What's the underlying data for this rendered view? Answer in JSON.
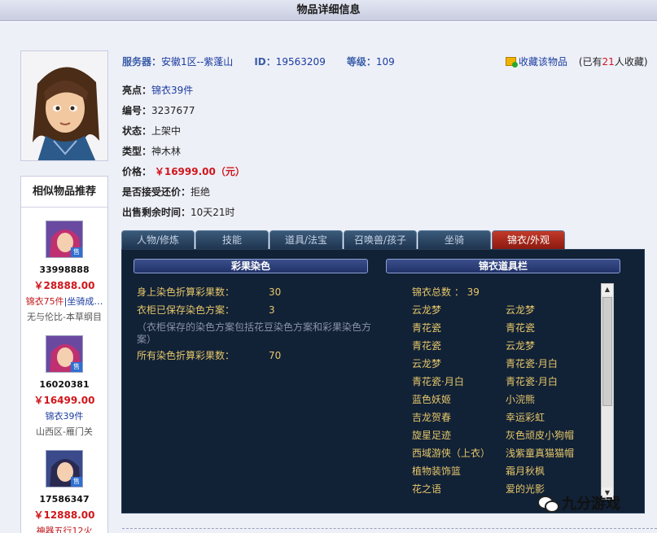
{
  "page": {
    "title": "物品详细信息"
  },
  "header_info": {
    "server_label": "服务器：",
    "server_value": "安徽1区--紫蓬山",
    "id_label": "ID：",
    "id_value": "19563209",
    "level_label": "等级：",
    "level_value": "109",
    "fav_label": "收藏该物品",
    "fav_prefix": "(已有",
    "fav_count": "21",
    "fav_suffix": "人收藏)"
  },
  "details": {
    "highlight_label": "亮点：",
    "highlight_value": "锦衣39件",
    "serial_label": "编号：",
    "serial_value": "3237677",
    "status_label": "状态：",
    "status_value": "上架中",
    "type_label": "类型：",
    "type_value": "神木林",
    "price_label": "价格：",
    "price_value": "￥16999.00（元）",
    "bargain_label": "是否接受还价：",
    "bargain_value": "拒绝",
    "remaining_label": "出售剩余时间：",
    "remaining_value": "10天21时"
  },
  "tabs": [
    "人物/修炼",
    "技能",
    "道具/法宝",
    "召唤兽/孩子",
    "坐骑",
    "锦衣/外观"
  ],
  "active_tab": 5,
  "similar": {
    "title": "相似物品推荐",
    "items": [
      {
        "id": "33998888",
        "price": "￥28888.00",
        "desc_red": "锦衣75件",
        "desc_rest": "|坐骑成…",
        "server": "无与伦比-本草纲目"
      },
      {
        "id": "16020381",
        "price": "￥16499.00",
        "desc_red": "",
        "desc_rest": "锦衣39件",
        "server": "山西区-雁门关"
      },
      {
        "id": "17586347",
        "price": "￥12888.00",
        "desc_red": "神器五行12火",
        "desc_rest": "",
        "server": ""
      }
    ],
    "badge": "售"
  },
  "dye": {
    "title": "彩果染色",
    "body_label": "身上染色折算彩果数：",
    "body_value": "30",
    "wardrobe_label": "衣柜已保存染色方案：",
    "wardrobe_value": "3",
    "note": "（衣柜保存的染色方案包括花豆染色方案和彩果染色方案）",
    "all_label": "所有染色折算彩果数：",
    "all_value": "70"
  },
  "jinyi": {
    "title": "锦衣道具栏",
    "total_label": "锦衣总数 ：",
    "total_value": "39",
    "items": [
      "云龙梦",
      "云龙梦",
      "青花瓷",
      "青花瓷",
      "青花瓷",
      "云龙梦",
      "云龙梦",
      "青花瓷·月白",
      "青花瓷·月白",
      "青花瓷·月白",
      "蓝色妖姬",
      "小浣熊",
      "吉龙贺春",
      "幸运彩虹",
      "旋星足迹",
      "灰色顽皮小狗帽",
      "西域游侠（上衣）",
      "浅紫童真猫猫帽",
      "植物装饰篮",
      "霜月秋枫",
      "花之语",
      "爱的光影"
    ]
  },
  "watermark": {
    "text": "九分游戏"
  },
  "colors": {
    "price_red": "#d0161b",
    "link_blue": "#1a3b9e",
    "gold": "#e6c76a",
    "panel_bg": "#112136",
    "tab_active": "#b02a1e"
  }
}
